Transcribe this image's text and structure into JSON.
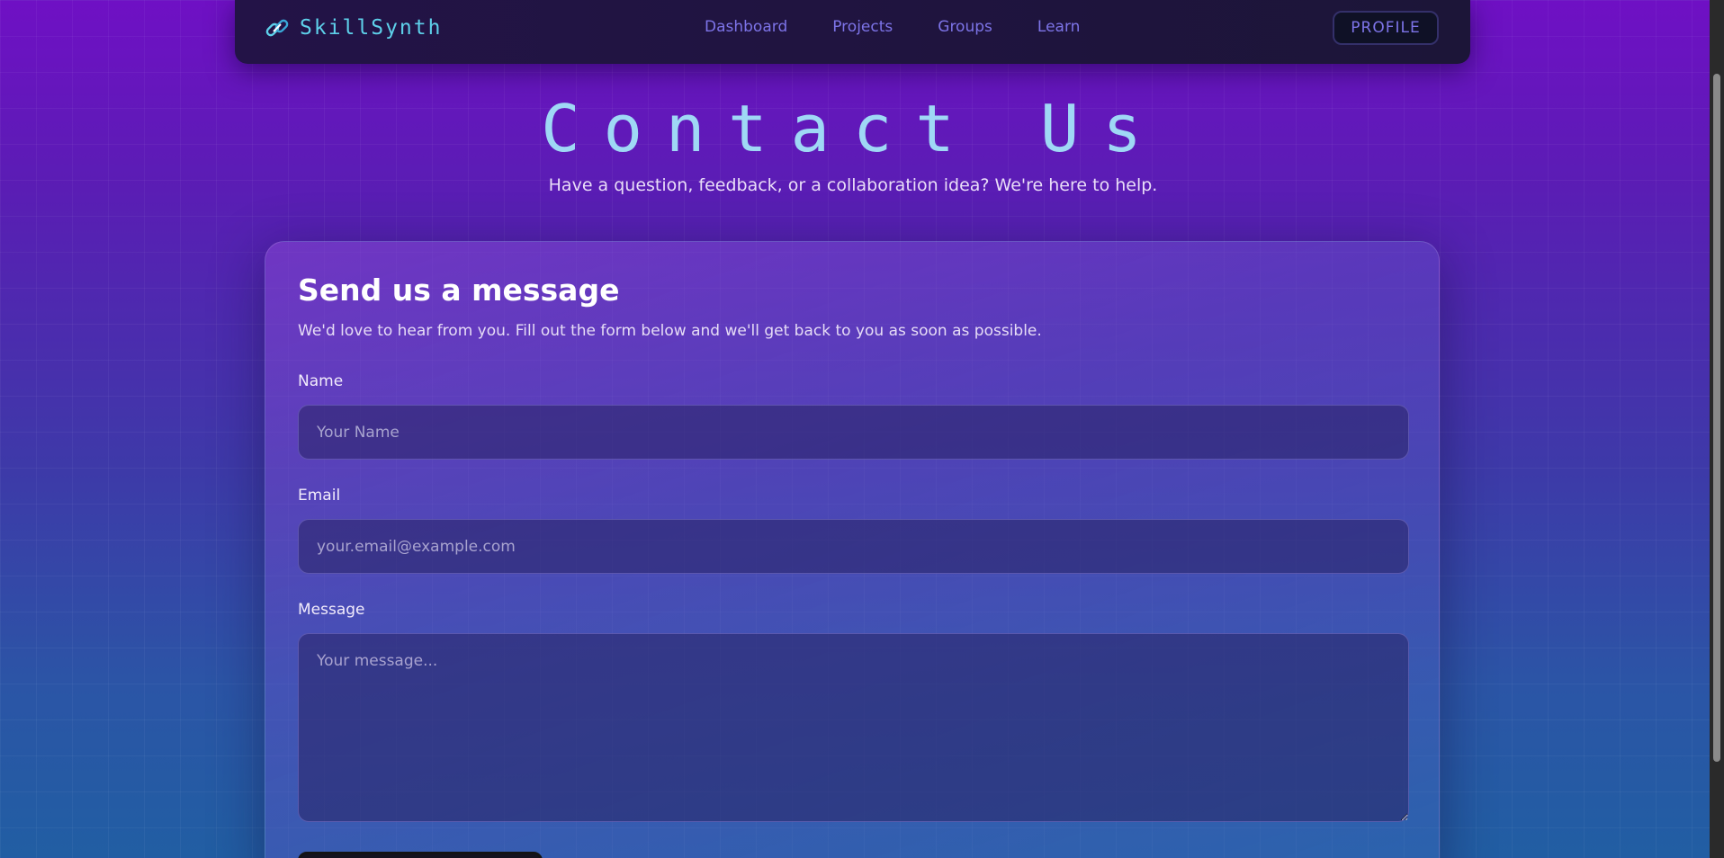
{
  "nav": {
    "brand": "SkillSynth",
    "brand_icon": "link-icon",
    "links": [
      "Dashboard",
      "Projects",
      "Groups",
      "Learn"
    ],
    "profile": "PROFILE"
  },
  "hero": {
    "title": "Contact Us",
    "subtitle": "Have a question, feedback, or a collaboration idea? We're here to help."
  },
  "form": {
    "title": "Send us a message",
    "description": "We'd love to hear from you. Fill out the form below and we'll get back to you as soon as possible.",
    "name_label": "Name",
    "name_placeholder": "Your Name",
    "email_label": "Email",
    "email_placeholder": "your.email@example.com",
    "message_label": "Message",
    "message_placeholder": "Your message..."
  },
  "colors": {
    "accent": "#5ed0ea",
    "nav_link": "#7d74e8",
    "title": "#9fd8f5"
  }
}
